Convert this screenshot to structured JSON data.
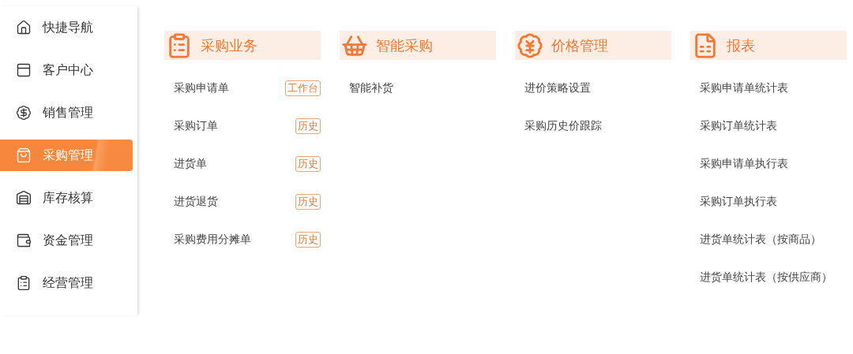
{
  "sidebar": {
    "items": [
      {
        "label": "快捷导航",
        "selected": false
      },
      {
        "label": "客户中心",
        "selected": false
      },
      {
        "label": "销售管理",
        "selected": false
      },
      {
        "label": "采购管理",
        "selected": true
      },
      {
        "label": "库存核算",
        "selected": false
      },
      {
        "label": "资金管理",
        "selected": false
      },
      {
        "label": "经营管理",
        "selected": false
      }
    ]
  },
  "sections": [
    {
      "title": "采购业务",
      "items": [
        {
          "label": "采购申请单",
          "tag": "工作台"
        },
        {
          "label": "采购订单",
          "tag": "历史"
        },
        {
          "label": "进货单",
          "tag": "历史"
        },
        {
          "label": "进货退货",
          "tag": "历史"
        },
        {
          "label": "采购费用分摊单",
          "tag": "历史"
        }
      ]
    },
    {
      "title": "智能采购",
      "items": [
        {
          "label": "智能补货"
        }
      ]
    },
    {
      "title": "价格管理",
      "items": [
        {
          "label": "进价策略设置"
        },
        {
          "label": "采购历史价跟踪"
        }
      ]
    },
    {
      "title": "报表",
      "items": [
        {
          "label": "采购申请单统计表"
        },
        {
          "label": "采购订单统计表"
        },
        {
          "label": "采购申请单执行表"
        },
        {
          "label": "采购订单执行表"
        },
        {
          "label": "进货单统计表（按商品）"
        },
        {
          "label": "进货单统计表（按供应商）"
        }
      ]
    }
  ]
}
